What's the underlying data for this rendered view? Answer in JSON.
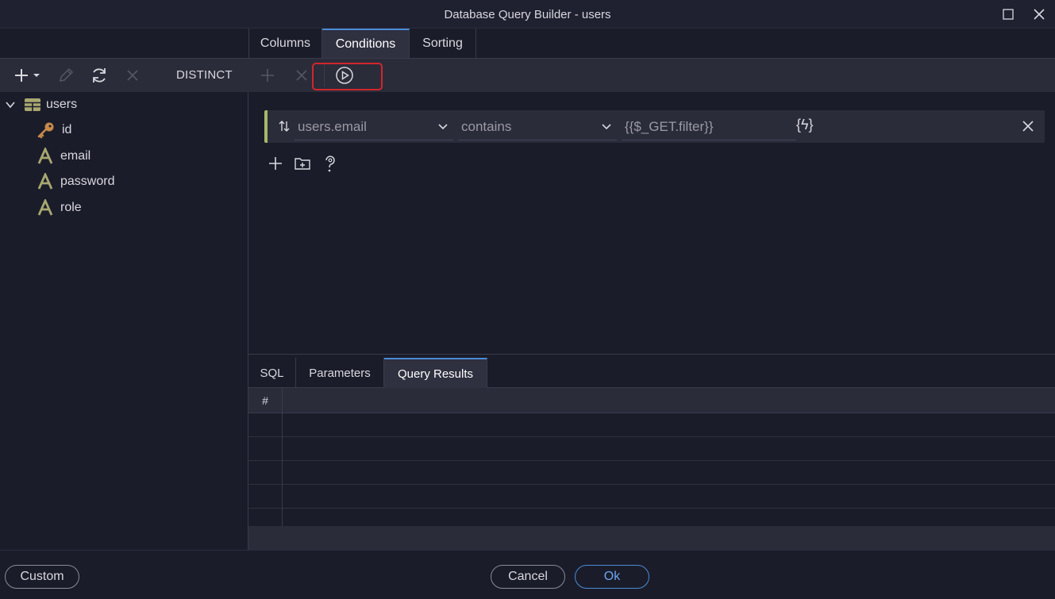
{
  "window": {
    "title": "Database Query Builder - users"
  },
  "tabs": [
    {
      "label": "Columns"
    },
    {
      "label": "Conditions",
      "active": true
    },
    {
      "label": "Sorting"
    }
  ],
  "toolbar": {
    "distinct_label": "DISTINCT"
  },
  "tree": {
    "table": "users",
    "columns": [
      {
        "name": "id",
        "icon": "key-icon"
      },
      {
        "name": "email",
        "icon": "text-type-icon"
      },
      {
        "name": "password",
        "icon": "text-type-icon"
      },
      {
        "name": "role",
        "icon": "text-type-icon"
      }
    ]
  },
  "condition": {
    "field": "users.email",
    "operator": "contains",
    "value": "{{$_GET.filter}}",
    "dynamic_button": "{ϟ}"
  },
  "bottom_tabs": [
    {
      "label": "SQL"
    },
    {
      "label": "Parameters"
    },
    {
      "label": "Query Results",
      "active": true
    }
  ],
  "results": {
    "index_header": "#"
  },
  "footer": {
    "custom_label": "Custom",
    "cancel_label": "Cancel",
    "ok_label": "Ok"
  },
  "colors": {
    "accent": "#4b8bd6",
    "highlight": "#d1262b",
    "condition_border": "#a8b86a",
    "icon_olive": "#a8a870",
    "key_orange": "#c88a4a"
  }
}
